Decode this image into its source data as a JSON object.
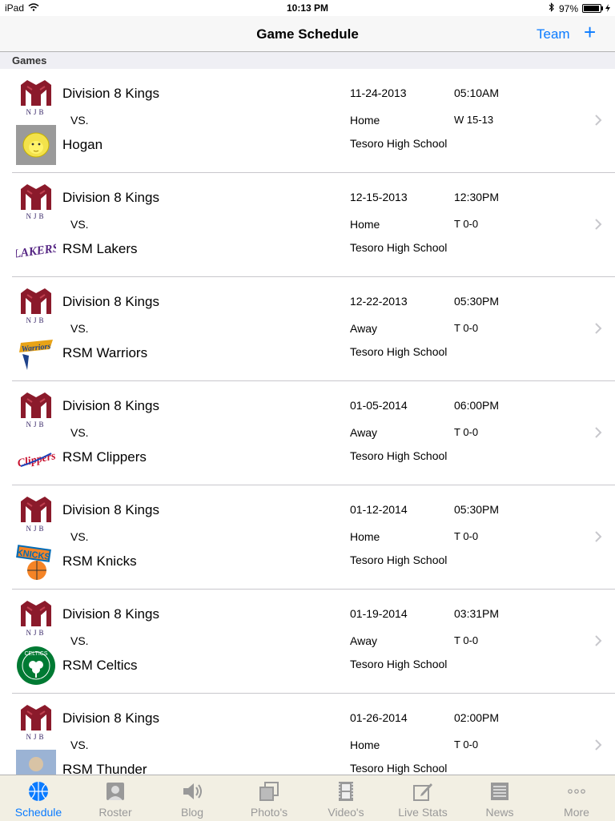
{
  "status": {
    "device": "iPad",
    "time": "10:13 PM",
    "battery": "97%"
  },
  "nav": {
    "title": "Game Schedule",
    "team": "Team",
    "add": "+"
  },
  "section": {
    "title": "Games"
  },
  "games": [
    {
      "home": "Division 8 Kings",
      "vs": "VS.",
      "opponent": "Hogan",
      "date": "11-24-2013",
      "time": "05:10AM",
      "location": "Home",
      "score": "W 15-13",
      "venue": "Tesoro High School",
      "opp_logo": "lion-logo-icon"
    },
    {
      "home": "Division 8 Kings",
      "vs": "VS.",
      "opponent": "RSM Lakers",
      "date": "12-15-2013",
      "time": "12:30PM",
      "location": "Home",
      "score": "T 0-0",
      "venue": "Tesoro High School",
      "opp_logo": "lakers-logo-icon"
    },
    {
      "home": "Division 8 Kings",
      "vs": "VS.",
      "opponent": "RSM Warriors",
      "date": "12-22-2013",
      "time": "05:30PM",
      "location": "Away",
      "score": "T 0-0",
      "venue": "Tesoro High School",
      "opp_logo": "warriors-logo-icon"
    },
    {
      "home": "Division 8 Kings",
      "vs": "VS.",
      "opponent": "RSM  Clippers",
      "date": "01-05-2014",
      "time": "06:00PM",
      "location": "Away",
      "score": "T 0-0",
      "venue": "Tesoro High School",
      "opp_logo": "clippers-logo-icon"
    },
    {
      "home": "Division 8 Kings",
      "vs": "VS.",
      "opponent": "RSM Knicks",
      "date": "01-12-2014",
      "time": "05:30PM",
      "location": "Home",
      "score": "T 0-0",
      "venue": "Tesoro High School",
      "opp_logo": "knicks-logo-icon"
    },
    {
      "home": "Division 8 Kings",
      "vs": "VS.",
      "opponent": "RSM Celtics",
      "date": "01-19-2014",
      "time": "03:31PM",
      "location": "Away",
      "score": "T 0-0",
      "venue": "Tesoro High School",
      "opp_logo": "celtics-logo-icon"
    },
    {
      "home": "Division 8 Kings",
      "vs": "VS.",
      "opponent": "RSM Thunder",
      "date": "01-26-2014",
      "time": "02:00PM",
      "location": "Home",
      "score": "T 0-0",
      "venue": "Tesoro High School",
      "opp_logo": "photo-placeholder-icon"
    }
  ],
  "tabs": [
    {
      "label": "Schedule",
      "icon": "basketball-icon",
      "active": true
    },
    {
      "label": "Roster",
      "icon": "roster-icon",
      "active": false
    },
    {
      "label": "Blog",
      "icon": "speaker-icon",
      "active": false
    },
    {
      "label": "Photo's",
      "icon": "photos-icon",
      "active": false
    },
    {
      "label": "Video's",
      "icon": "film-icon",
      "active": false
    },
    {
      "label": "Live Stats",
      "icon": "edit-icon",
      "active": false
    },
    {
      "label": "News",
      "icon": "newspaper-icon",
      "active": false
    },
    {
      "label": "More",
      "icon": "more-icon",
      "active": false
    }
  ],
  "colors": {
    "accent": "#0a7bff",
    "rsm_logo": "#8b1a2b",
    "tabbar_bg": "#f2efe3"
  }
}
